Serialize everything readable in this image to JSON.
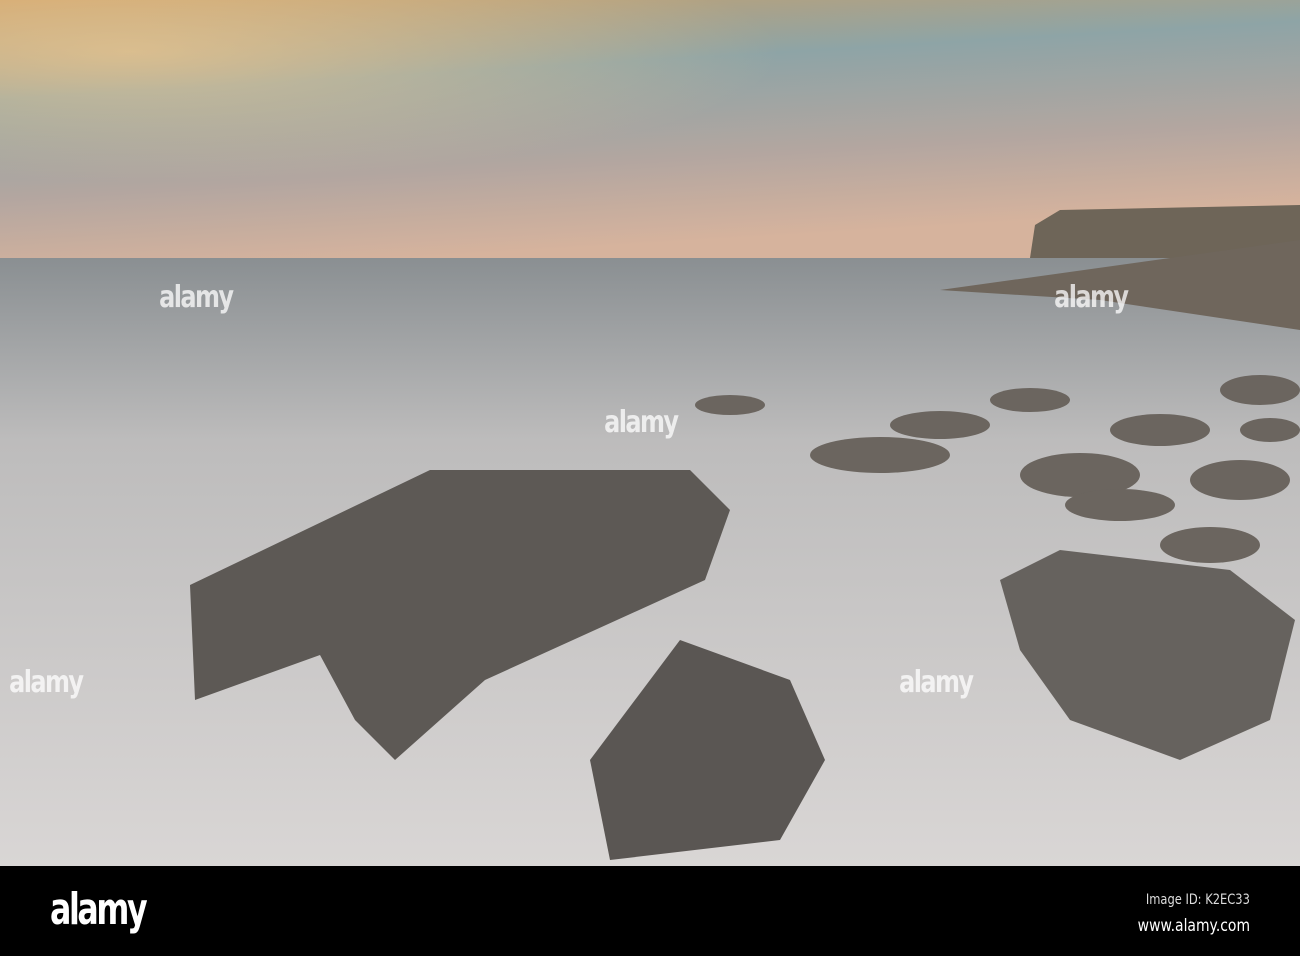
{
  "watermark": {
    "text": "alamy"
  },
  "footer": {
    "logo": "alamy",
    "image_id": "Image ID: K2EC33",
    "url": "www.alamy.com"
  }
}
